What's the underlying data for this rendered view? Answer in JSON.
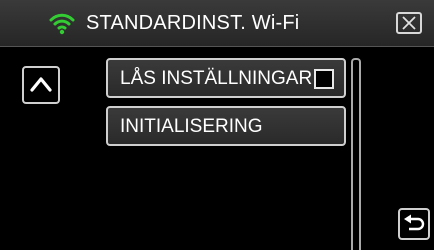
{
  "header": {
    "title": "STANDARDINST. Wi-Fi",
    "wifi_icon": "wifi-icon",
    "close_icon": "close-icon",
    "accent_color": "#33cc33"
  },
  "menu": {
    "items": [
      {
        "label": "LÅS INSTÄLLNINGAR",
        "checkbox": true,
        "checked": false
      },
      {
        "label": "INITIALISERING"
      }
    ]
  },
  "nav": {
    "up_icon": "chevron-up-icon",
    "back_icon": "return-arrow-icon"
  }
}
